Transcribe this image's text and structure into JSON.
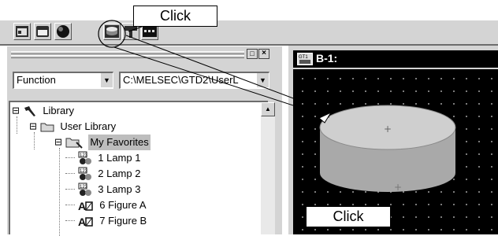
{
  "callouts": {
    "top": "Click",
    "bottom": "Click"
  },
  "toolbar": {
    "buttons": [
      {
        "icon": "window-icon"
      },
      {
        "icon": "switch-icon"
      },
      {
        "icon": "lamp-icon"
      },
      {
        "icon": "cylinder-icon"
      },
      {
        "icon": "parts-icon"
      },
      {
        "icon": "data-view-icon"
      }
    ]
  },
  "panel": {
    "function_select": "Function",
    "path_select": "C:\\MELSEC\\GTD2\\UserL",
    "tree": [
      {
        "label": "Library",
        "icon": "hammer-icon",
        "expander": "⊟"
      },
      {
        "label": "User Library",
        "icon": "folder-icon",
        "expander": "⊟"
      },
      {
        "label": "My Favorites",
        "icon": "favorites-folder-icon",
        "expander": "⊟",
        "selected": true
      },
      {
        "label": "1 Lamp 1",
        "icon": "numeric-lamp-icon"
      },
      {
        "label": "2 Lamp 2",
        "icon": "numeric-lamp-icon"
      },
      {
        "label": "3 Lamp 3",
        "icon": "numeric-lamp-icon"
      },
      {
        "label": "6 Figure A",
        "icon": "figure-icon"
      },
      {
        "label": "7 Figure B",
        "icon": "figure-icon"
      }
    ]
  },
  "screen": {
    "title": "B-1:",
    "title_icon": "screen-icon"
  },
  "colors": {
    "canvas_bg": "#000000",
    "cylinder_top": "#cfcfcf",
    "cylinder_side": "#a9a9a9"
  }
}
